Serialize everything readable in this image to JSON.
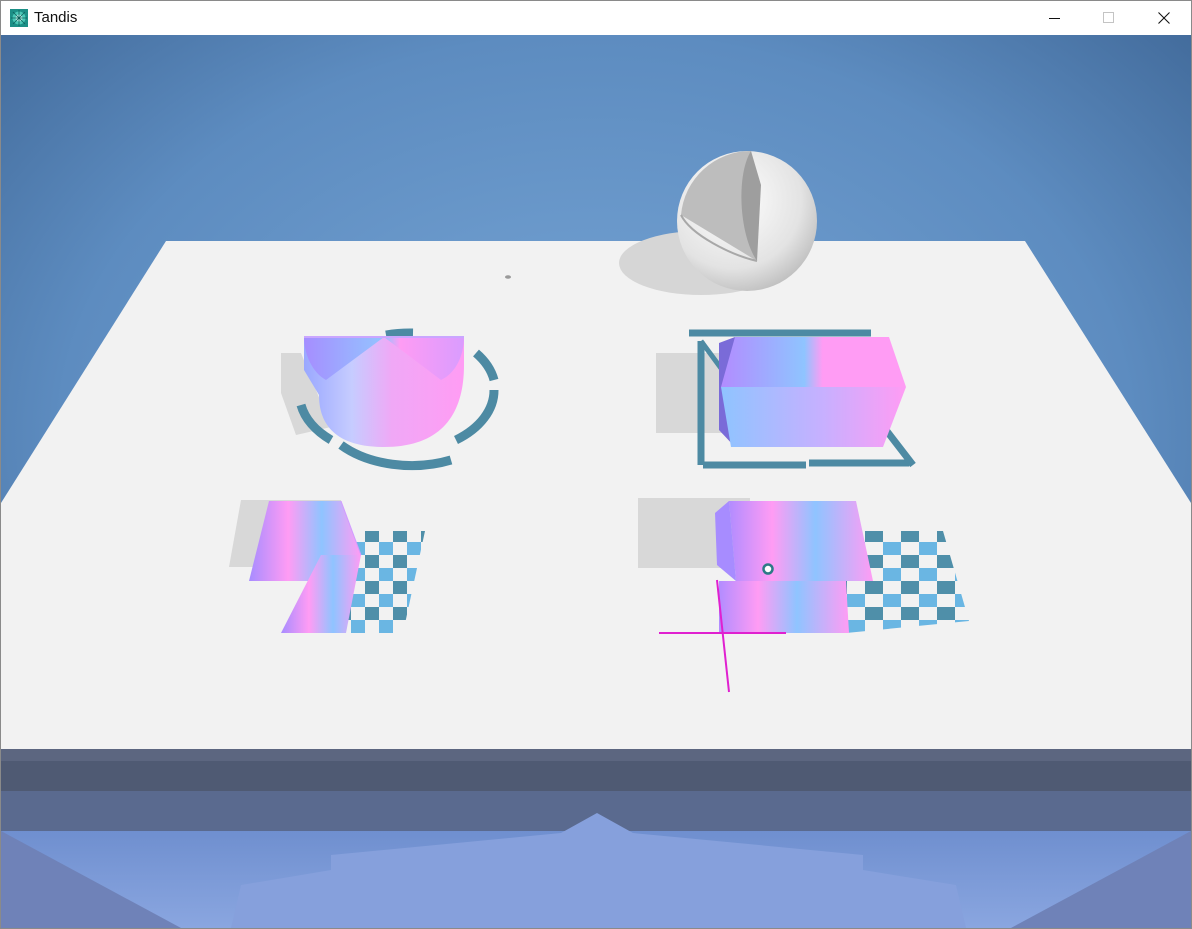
{
  "window": {
    "title": "Tandis"
  },
  "icons": {
    "app": "tandis-app-icon",
    "minimize": "minimize-icon",
    "maximize": "maximize-icon",
    "close": "close-icon"
  },
  "colors": {
    "sky_top": "#3f6796",
    "sky_mid": "#6b98c8",
    "table_top": "#f2f2f2",
    "gradient_pink": "#ff9cf4",
    "gradient_blue": "#8fc4ff",
    "gradient_violet": "#a78cff",
    "outline_teal": "#4d8aa3",
    "checker_teal": "#4f8fa9",
    "checker_light": "#6ab6e3",
    "cursor_magenta": "#e020d0",
    "sphere_white": "#f3f3f3"
  }
}
